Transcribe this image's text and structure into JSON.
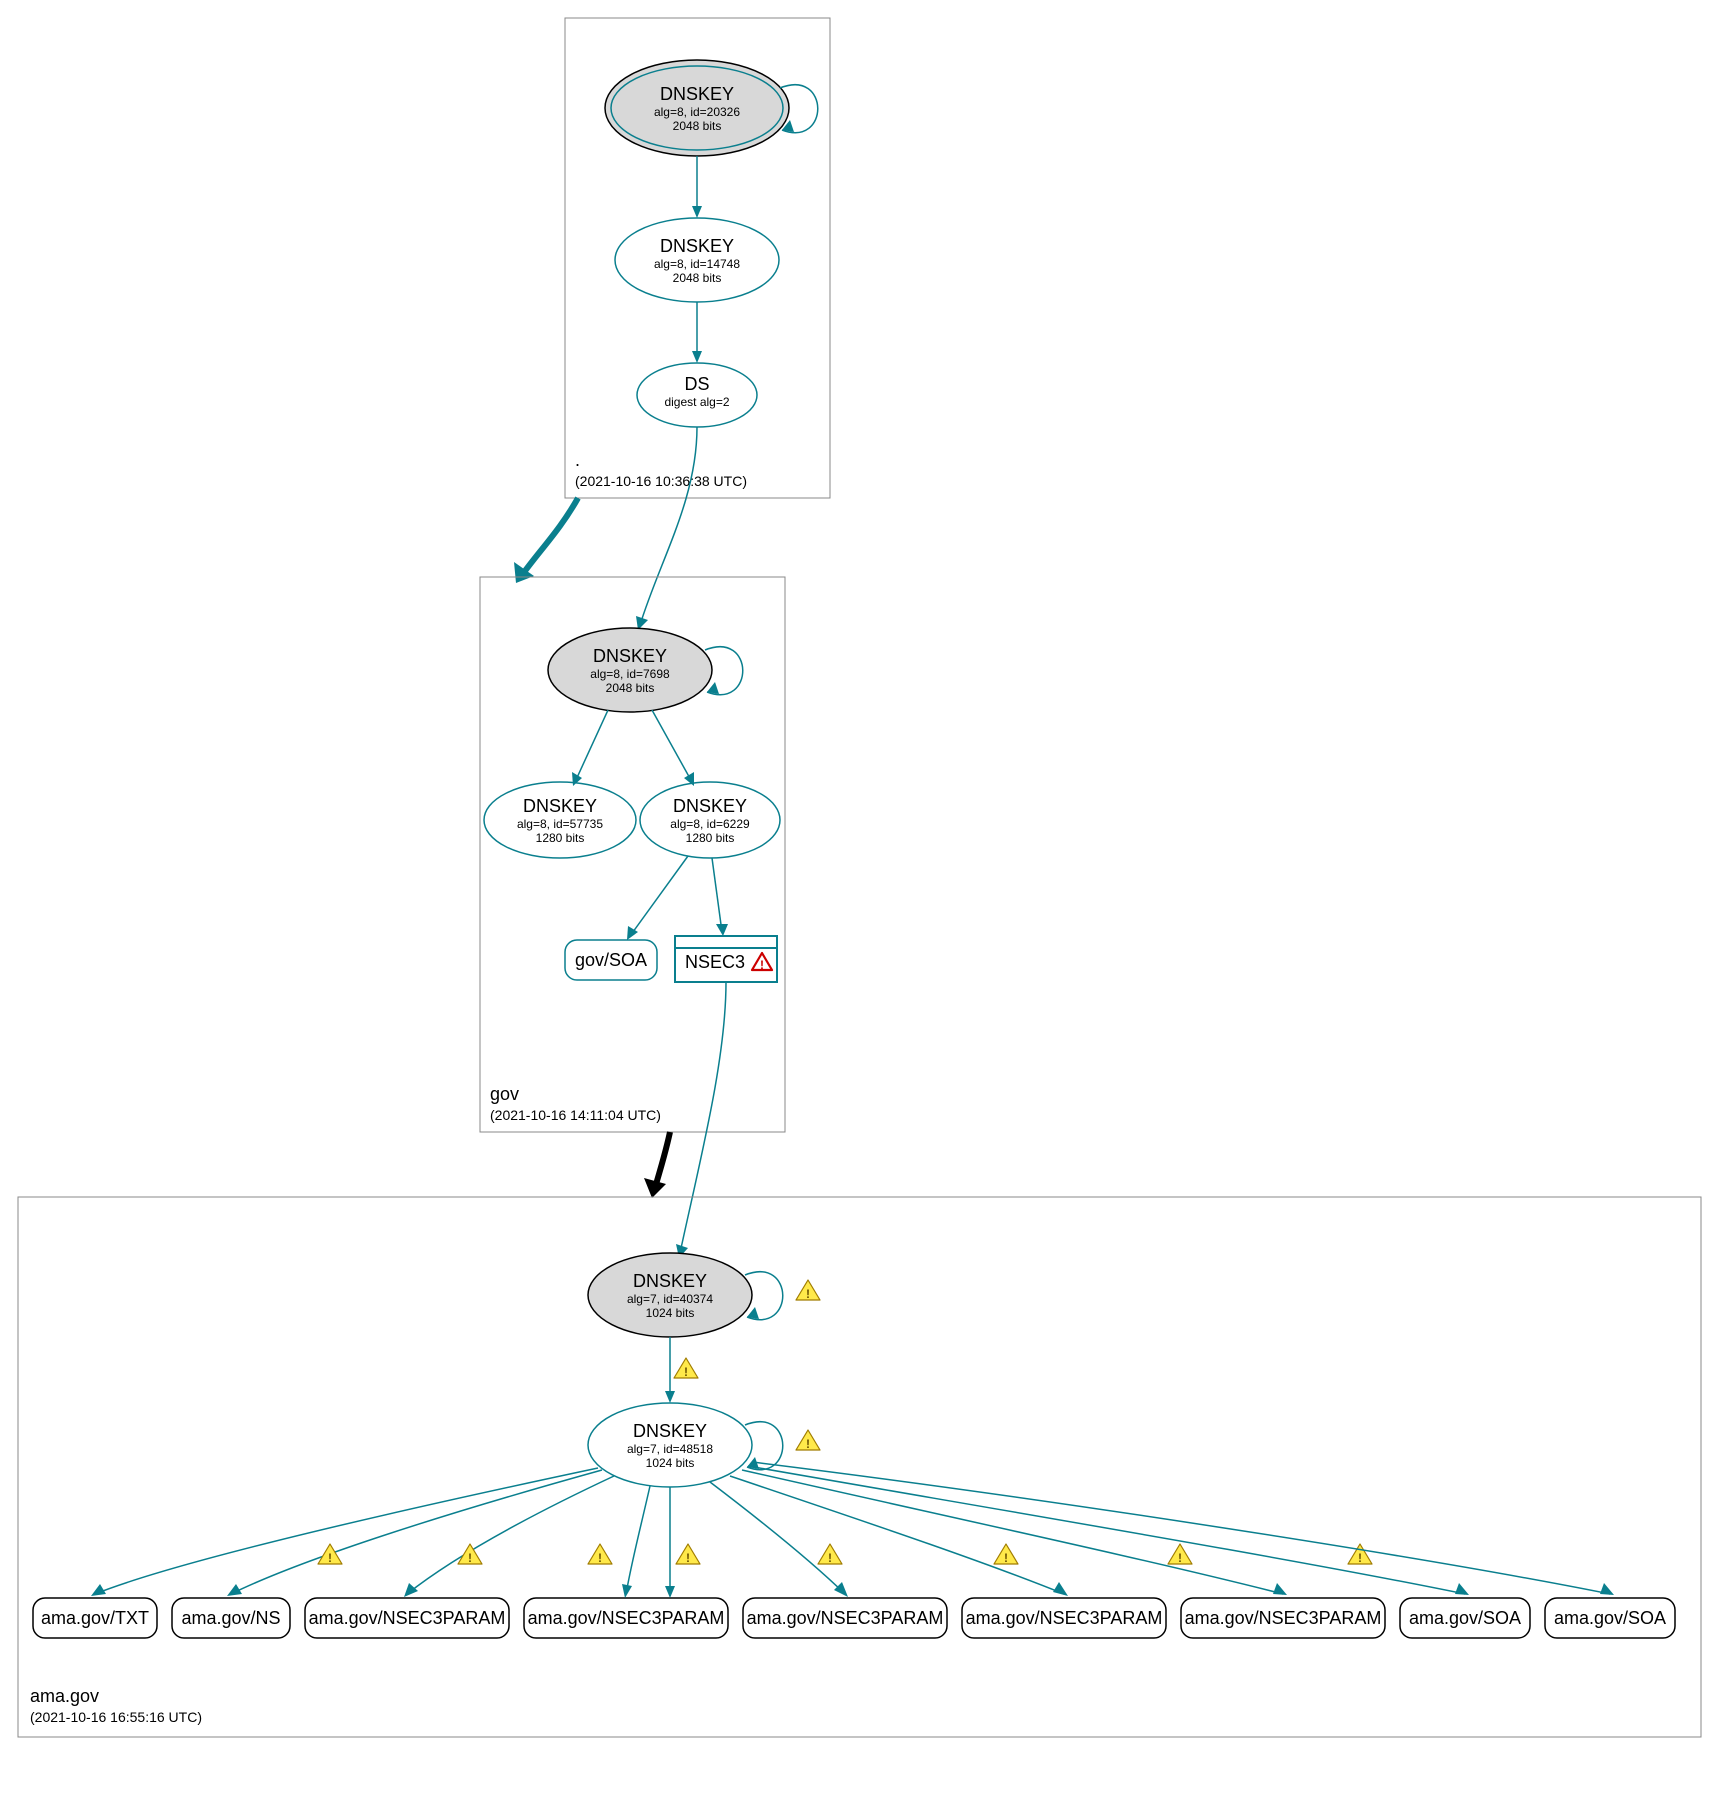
{
  "zones": {
    "root": {
      "name_label": ".",
      "timestamp": "(2021-10-16 10:36:38 UTC)"
    },
    "gov": {
      "name_label": "gov",
      "timestamp": "(2021-10-16 14:11:04 UTC)"
    },
    "ama": {
      "name_label": "ama.gov",
      "timestamp": "(2021-10-16 16:55:16 UTC)"
    }
  },
  "nodes": {
    "root_ksk": {
      "title": "DNSKEY",
      "line2": "alg=8, id=20326",
      "line3": "2048 bits"
    },
    "root_zsk": {
      "title": "DNSKEY",
      "line2": "alg=8, id=14748",
      "line3": "2048 bits"
    },
    "root_ds": {
      "title": "DS",
      "line2": "digest alg=2"
    },
    "gov_ksk": {
      "title": "DNSKEY",
      "line2": "alg=8, id=7698",
      "line3": "2048 bits"
    },
    "gov_zsk1": {
      "title": "DNSKEY",
      "line2": "alg=8, id=57735",
      "line3": "1280 bits"
    },
    "gov_zsk2": {
      "title": "DNSKEY",
      "line2": "alg=8, id=6229",
      "line3": "1280 bits"
    },
    "gov_soa": {
      "label": "gov/SOA"
    },
    "gov_nsec3": {
      "label": "NSEC3"
    },
    "ama_ksk": {
      "title": "DNSKEY",
      "line2": "alg=7, id=40374",
      "line3": "1024 bits"
    },
    "ama_zsk": {
      "title": "DNSKEY",
      "line2": "alg=7, id=48518",
      "line3": "1024 bits"
    }
  },
  "ama_records": [
    {
      "label": "ama.gov/TXT"
    },
    {
      "label": "ama.gov/NS"
    },
    {
      "label": "ama.gov/NSEC3PARAM"
    },
    {
      "label": "ama.gov/NSEC3PARAM"
    },
    {
      "label": "ama.gov/NSEC3PARAM"
    },
    {
      "label": "ama.gov/NSEC3PARAM"
    },
    {
      "label": "ama.gov/NSEC3PARAM"
    },
    {
      "label": "ama.gov/SOA"
    },
    {
      "label": "ama.gov/SOA"
    }
  ],
  "colors": {
    "teal": "#0a7f8e",
    "ksk_fill": "#d8d8d8",
    "warn_fill": "#ffe94a",
    "error_stroke": "#cc0000"
  }
}
